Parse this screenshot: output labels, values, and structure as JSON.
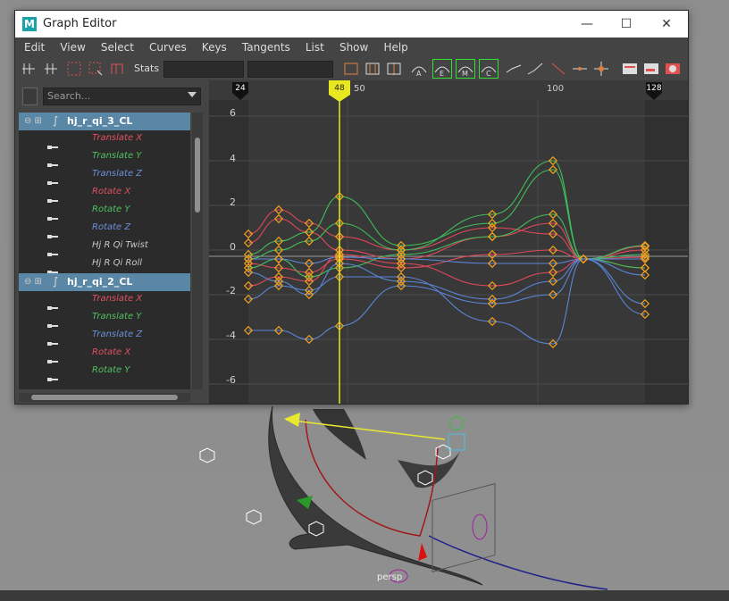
{
  "window": {
    "title": "Graph Editor",
    "app_icon": "M",
    "minimize": "—",
    "maximize": "☐",
    "close": "✕"
  },
  "menu": [
    "Edit",
    "View",
    "Select",
    "Curves",
    "Keys",
    "Tangents",
    "List",
    "Show",
    "Help"
  ],
  "toolbar": {
    "stats_label": "Stats",
    "stats_value_1": "",
    "stats_value_2": "",
    "tangent_buttons": [
      "A",
      "E",
      "M",
      "C"
    ]
  },
  "outliner": {
    "search_placeholder": "Search...",
    "rows": [
      {
        "type": "node",
        "label": "hj_r_qi_3_CL"
      },
      {
        "type": "attr",
        "label": "Translate X",
        "color": "#e05060"
      },
      {
        "type": "attr",
        "label": "Translate Y",
        "color": "#50c060"
      },
      {
        "type": "attr",
        "label": "Translate Z",
        "color": "#6a8fd8"
      },
      {
        "type": "attr",
        "label": "Rotate X",
        "color": "#e05060"
      },
      {
        "type": "attr",
        "label": "Rotate Y",
        "color": "#50c060"
      },
      {
        "type": "attr",
        "label": "Rotate Z",
        "color": "#6a8fd8"
      },
      {
        "type": "attr",
        "label": "Hj R Qi Twist",
        "color": "#c8c8c8"
      },
      {
        "type": "attr",
        "label": "Hj R Qi Roll",
        "color": "#c8c8c8"
      },
      {
        "type": "node",
        "label": "hj_r_qi_2_CL"
      },
      {
        "type": "attr",
        "label": "Translate X",
        "color": "#e05060"
      },
      {
        "type": "attr",
        "label": "Translate Y",
        "color": "#50c060"
      },
      {
        "type": "attr",
        "label": "Translate Z",
        "color": "#6a8fd8"
      },
      {
        "type": "attr",
        "label": "Rotate X",
        "color": "#e05060"
      },
      {
        "type": "attr",
        "label": "Rotate Y",
        "color": "#50c060"
      }
    ]
  },
  "graph": {
    "frame_start": "24",
    "current_frame": "48",
    "frame_end": "128",
    "x_tick_labels": [
      "50",
      "100"
    ],
    "y_tick_labels": [
      "6",
      "4",
      "2",
      "0",
      "-2",
      "-4",
      "-6"
    ],
    "colors": {
      "red": "#e0485a",
      "green": "#3fbf5a",
      "blue": "#5a86d8",
      "key": "#f0a020",
      "playhead": "#e8e820"
    }
  },
  "viewport": {
    "camera_label": "persp"
  }
}
